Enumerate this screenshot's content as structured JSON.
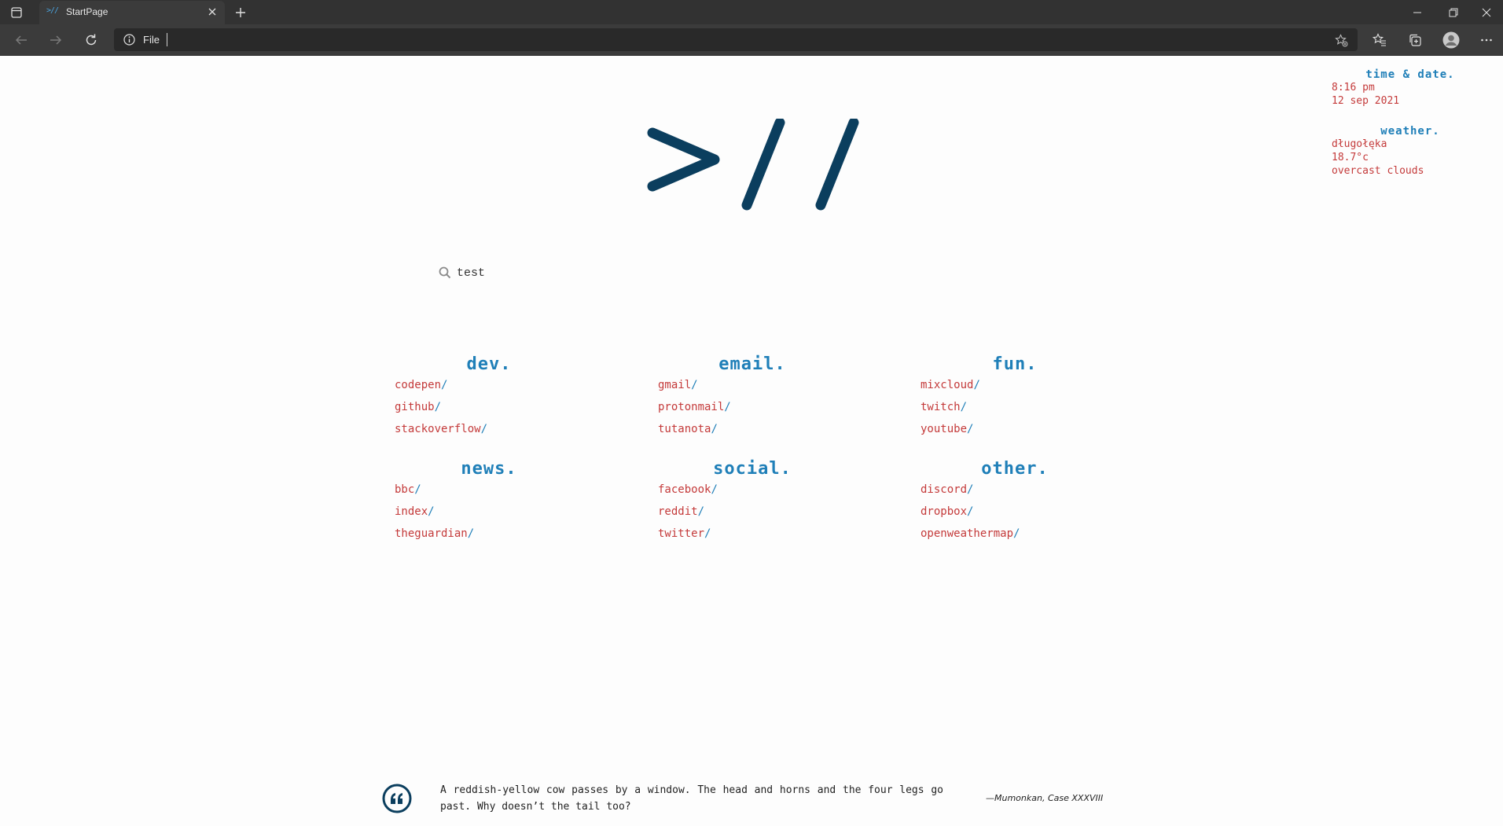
{
  "browser": {
    "tab_title": "StartPage",
    "tab_favicon": ">//",
    "address_scheme": "File",
    "address_value": ""
  },
  "search": {
    "value": "test",
    "placeholder": ""
  },
  "groups": [
    {
      "title": "dev.",
      "links": [
        "codepen",
        "github",
        "stackoverflow"
      ]
    },
    {
      "title": "email.",
      "links": [
        "gmail",
        "protonmail",
        "tutanota"
      ]
    },
    {
      "title": "fun.",
      "links": [
        "mixcloud",
        "twitch",
        "youtube"
      ]
    },
    {
      "title": "news.",
      "links": [
        "bbc",
        "index",
        "theguardian"
      ]
    },
    {
      "title": "social.",
      "links": [
        "facebook",
        "reddit",
        "twitter"
      ]
    },
    {
      "title": "other.",
      "links": [
        "discord",
        "dropbox",
        "openweathermap"
      ]
    }
  ],
  "link_suffix": "/",
  "time_date": {
    "title": "time & date.",
    "time": "8:16 pm",
    "date": "12 sep 2021"
  },
  "weather": {
    "title": "weather.",
    "location": "długołęka",
    "temperature": "18.7°c",
    "description": "overcast clouds"
  },
  "quote": {
    "text": "A reddish-yellow cow passes by a window. The head and horns and the four legs go past. Why doesn’t the tail too?",
    "author": "—Mumonkan, Case XXXVIII"
  },
  "colors": {
    "accent": "#1f7fb8",
    "link": "#c43a3a",
    "logo": "#0b3e5e"
  }
}
